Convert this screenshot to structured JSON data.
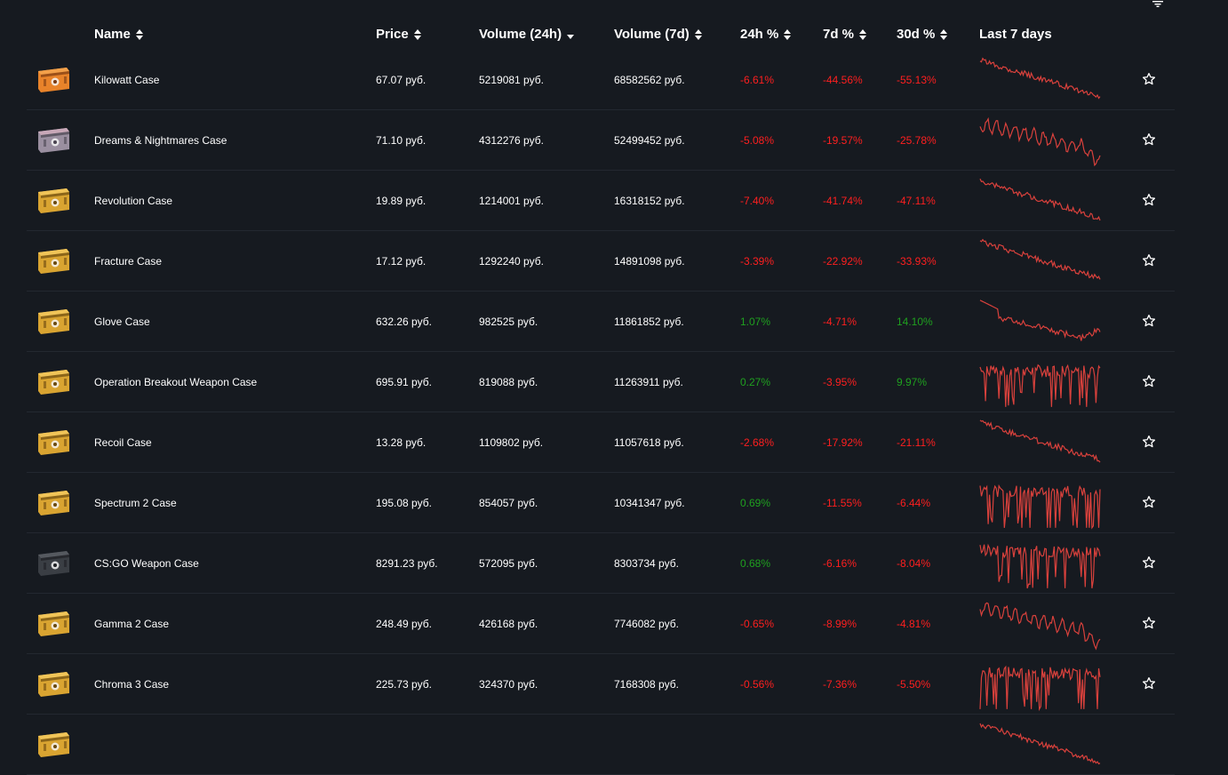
{
  "header": {
    "name": "Name",
    "price": "Price",
    "vol24": "Volume (24h)",
    "vol7": "Volume (7d)",
    "p24": "24h %",
    "p7": "7d %",
    "p30": "30d %",
    "last7": "Last 7 days"
  },
  "colors": {
    "background": "#161a20",
    "negative": "#ff1f1f",
    "positive": "#1fa01f",
    "sparkline": "#d9413c"
  },
  "rows": [
    {
      "name": "Kilowatt Case",
      "price": "67.07 руб.",
      "vol24": "5219081 руб.",
      "vol7": "68582562 руб.",
      "p24": "-6.61%",
      "p7": "-44.56%",
      "p30": "-55.13%",
      "color": "orange",
      "trend": "down"
    },
    {
      "name": "Dreams & Nightmares Case",
      "price": "71.10 руб.",
      "vol24": "4312276 руб.",
      "vol7": "52499452 руб.",
      "p24": "-5.08%",
      "p7": "-19.57%",
      "p30": "-25.78%",
      "color": "pinkgrey",
      "trend": "wavy-down"
    },
    {
      "name": "Revolution Case",
      "price": "19.89 руб.",
      "vol24": "1214001 руб.",
      "vol7": "16318152 руб.",
      "p24": "-7.40%",
      "p7": "-41.74%",
      "p30": "-47.11%",
      "color": "gold",
      "trend": "down"
    },
    {
      "name": "Fracture Case",
      "price": "17.12 руб.",
      "vol24": "1292240 руб.",
      "vol7": "14891098 руб.",
      "p24": "-3.39%",
      "p7": "-22.92%",
      "p30": "-33.93%",
      "color": "gold",
      "trend": "down"
    },
    {
      "name": "Glove Case",
      "price": "632.26 руб.",
      "vol24": "982525 руб.",
      "vol7": "11861852 руб.",
      "p24": "1.07%",
      "p7": "-4.71%",
      "p30": "14.10%",
      "color": "gold",
      "trend": "dip"
    },
    {
      "name": "Operation Breakout Weapon Case",
      "price": "695.91 руб.",
      "vol24": "819088 руб.",
      "vol7": "11263911 руб.",
      "p24": "0.27%",
      "p7": "-3.95%",
      "p30": "9.97%",
      "color": "gold",
      "trend": "noisy"
    },
    {
      "name": "Recoil Case",
      "price": "13.28 руб.",
      "vol24": "1109802 руб.",
      "vol7": "11057618 руб.",
      "p24": "-2.68%",
      "p7": "-17.92%",
      "p30": "-21.11%",
      "color": "gold",
      "trend": "down"
    },
    {
      "name": "Spectrum 2 Case",
      "price": "195.08 руб.",
      "vol24": "854057 руб.",
      "vol7": "10341347 руб.",
      "p24": "0.69%",
      "p7": "-11.55%",
      "p30": "-6.44%",
      "color": "gold",
      "trend": "noisy"
    },
    {
      "name": "CS:GO Weapon Case",
      "price": "8291.23 руб.",
      "vol24": "572095 руб.",
      "vol7": "8303734 руб.",
      "p24": "0.68%",
      "p7": "-6.16%",
      "p30": "-8.04%",
      "color": "dark",
      "trend": "noisy"
    },
    {
      "name": "Gamma 2 Case",
      "price": "248.49 руб.",
      "vol24": "426168 руб.",
      "vol7": "7746082 руб.",
      "p24": "-0.65%",
      "p7": "-8.99%",
      "p30": "-4.81%",
      "color": "gold",
      "trend": "wavy-down"
    },
    {
      "name": "Chroma 3 Case",
      "price": "225.73 руб.",
      "vol24": "324370 руб.",
      "vol7": "7168308 руб.",
      "p24": "-0.56%",
      "p7": "-7.36%",
      "p30": "-5.50%",
      "color": "gold",
      "trend": "noisy"
    },
    {
      "name": "",
      "price": "",
      "vol24": "",
      "vol7": "",
      "p24": "",
      "p7": "",
      "p30": "",
      "color": "gold",
      "trend": "down"
    }
  ]
}
